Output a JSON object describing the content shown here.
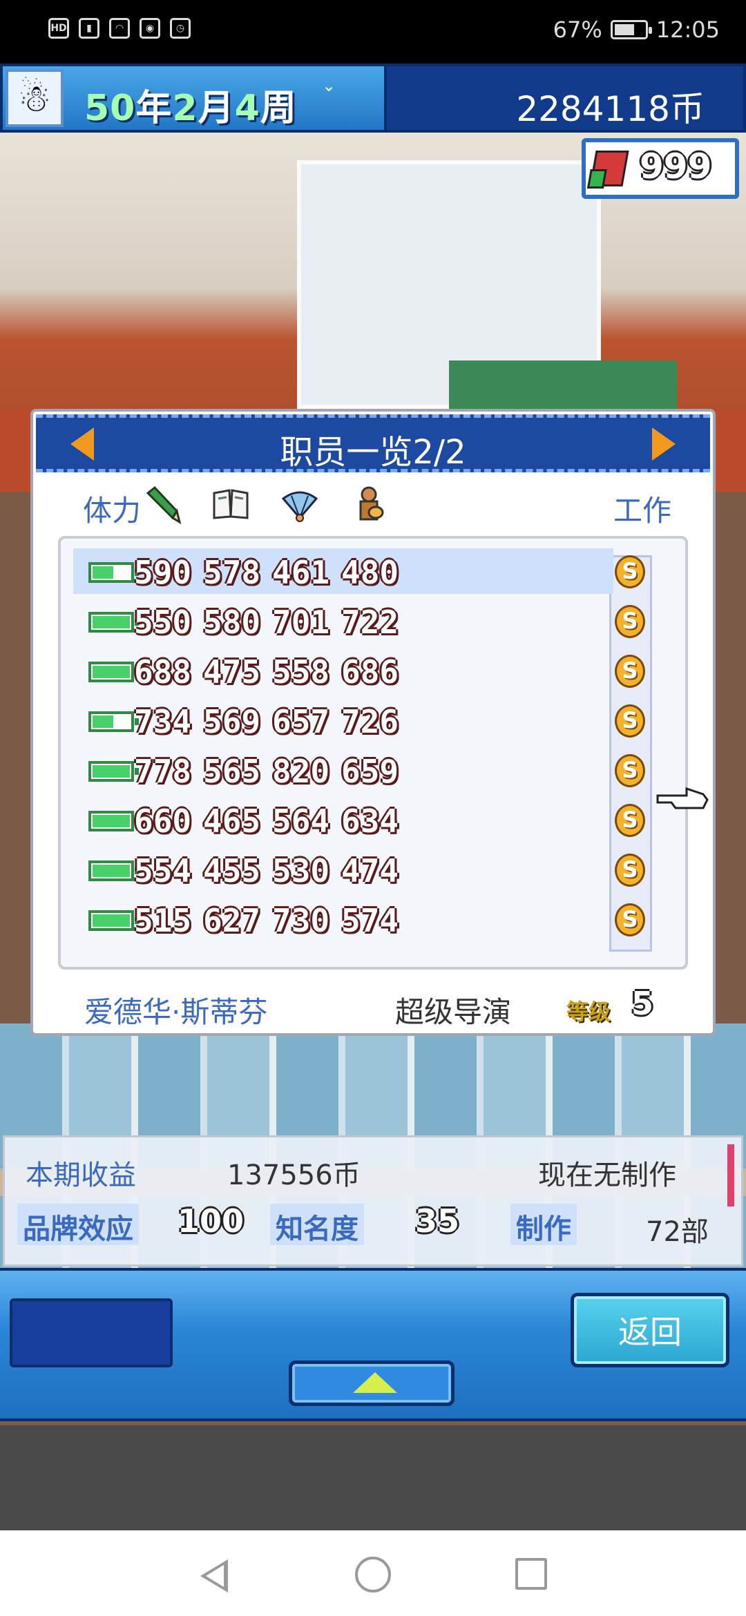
{
  "status_bar": {
    "left_icons": [
      "hd-icon",
      "signal-icon",
      "wifi-icon",
      "eye-icon",
      "alarm-icon"
    ],
    "battery_percent": "67%",
    "battery_level": 0.67,
    "time": "12:05"
  },
  "hud": {
    "year": "50",
    "year_unit": "年",
    "month": "2",
    "month_unit": "月",
    "week": "4",
    "week_unit": "周",
    "coins": "2284118币",
    "gift_count": "999"
  },
  "panel": {
    "title": "职员一览2/2",
    "col_stamina": "体力",
    "col_work": "工作",
    "stat_icons": [
      "pencil-icon",
      "book-icon",
      "fan-icon",
      "guitar-player-icon"
    ],
    "rows": [
      {
        "battery": 0.55,
        "stats": [
          "590",
          "578",
          "461",
          "480"
        ],
        "work": "S"
      },
      {
        "battery": 1.0,
        "stats": [
          "550",
          "580",
          "701",
          "722"
        ],
        "work": "S"
      },
      {
        "battery": 1.0,
        "stats": [
          "688",
          "475",
          "558",
          "686"
        ],
        "work": "S"
      },
      {
        "battery": 0.55,
        "stats": [
          "734",
          "569",
          "657",
          "726"
        ],
        "work": "S"
      },
      {
        "battery": 1.0,
        "stats": [
          "778",
          "565",
          "820",
          "659"
        ],
        "work": "S"
      },
      {
        "battery": 1.0,
        "stats": [
          "660",
          "465",
          "564",
          "634"
        ],
        "work": "S"
      },
      {
        "battery": 1.0,
        "stats": [
          "554",
          "455",
          "530",
          "474"
        ],
        "work": "S"
      },
      {
        "battery": 1.0,
        "stats": [
          "515",
          "627",
          "730",
          "574"
        ],
        "work": "S"
      }
    ],
    "staff_name": "爱德华·斯蒂芬",
    "staff_role": "超级导演",
    "level_label": "等级",
    "level_value": "5"
  },
  "summary": {
    "income_label": "本期收益",
    "income_value": "137556币",
    "production_status": "现在无制作",
    "brand_label": "品牌效应",
    "brand_value": "100",
    "fame_label": "知名度",
    "fame_value": "35",
    "made_label": "制作",
    "made_value": "72部"
  },
  "controls": {
    "back_label": "返回"
  },
  "colors": {
    "accent_blue": "#1c4aa0",
    "label_blue": "#3a69c0",
    "coin_gold": "#f4b12a",
    "battery_green": "#48d06a"
  }
}
